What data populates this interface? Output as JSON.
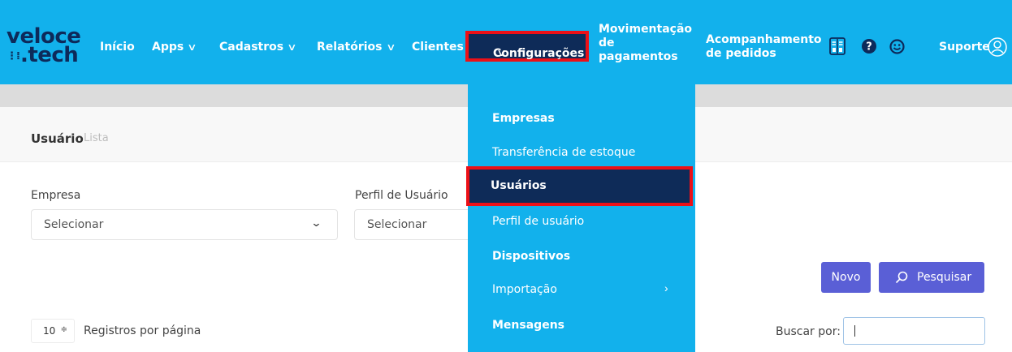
{
  "logo": {
    "line1": "veloce",
    "dots": "⋮⁞",
    "line2": ".tech"
  },
  "nav": {
    "inicio": "Início",
    "apps": "Apps",
    "cadastros": "Cadastros",
    "relatorios": "Relatórios",
    "clientes": "Clientes",
    "configuracoes": "Configurações",
    "movimentacao": [
      "Movimentação",
      "de",
      "pagamentos"
    ],
    "acompanhamento": [
      "Acompanhamento",
      "de pedidos"
    ],
    "suporte": "Suporte",
    "chevron": "∨"
  },
  "icons": {
    "manual": "book-icon",
    "help": "question-circle-icon",
    "smile": "smile-icon",
    "user": "user-circle-icon"
  },
  "page": {
    "title": "Usuário",
    "subtitle": "Lista"
  },
  "filters": {
    "empresa_label": "Empresa",
    "empresa_value": "Selecionar",
    "perfil_label": "Perfil de Usuário",
    "perfil_value": "Selecionar",
    "caret": "⌄"
  },
  "buttons": {
    "novo": "Novo",
    "pesquisar": "Pesquisar"
  },
  "table_controls": {
    "per_page_value": "10",
    "per_page_spinner": "≑",
    "per_page_label": "Registros por página",
    "search_label": "Buscar por:",
    "search_value": ""
  },
  "dropdown": {
    "items": [
      "Empresas",
      "Transferência de estoque",
      "Usuários",
      "Perfil de usuário",
      "Dispositivos",
      "Importação",
      "Mensagens"
    ],
    "submenu_arrow": "›",
    "selected": "Usuários"
  },
  "colors": {
    "navbar": "#12b1ec",
    "active": "#0e2b58",
    "highlight": "#ec1017",
    "button": "#5a5fd6"
  }
}
